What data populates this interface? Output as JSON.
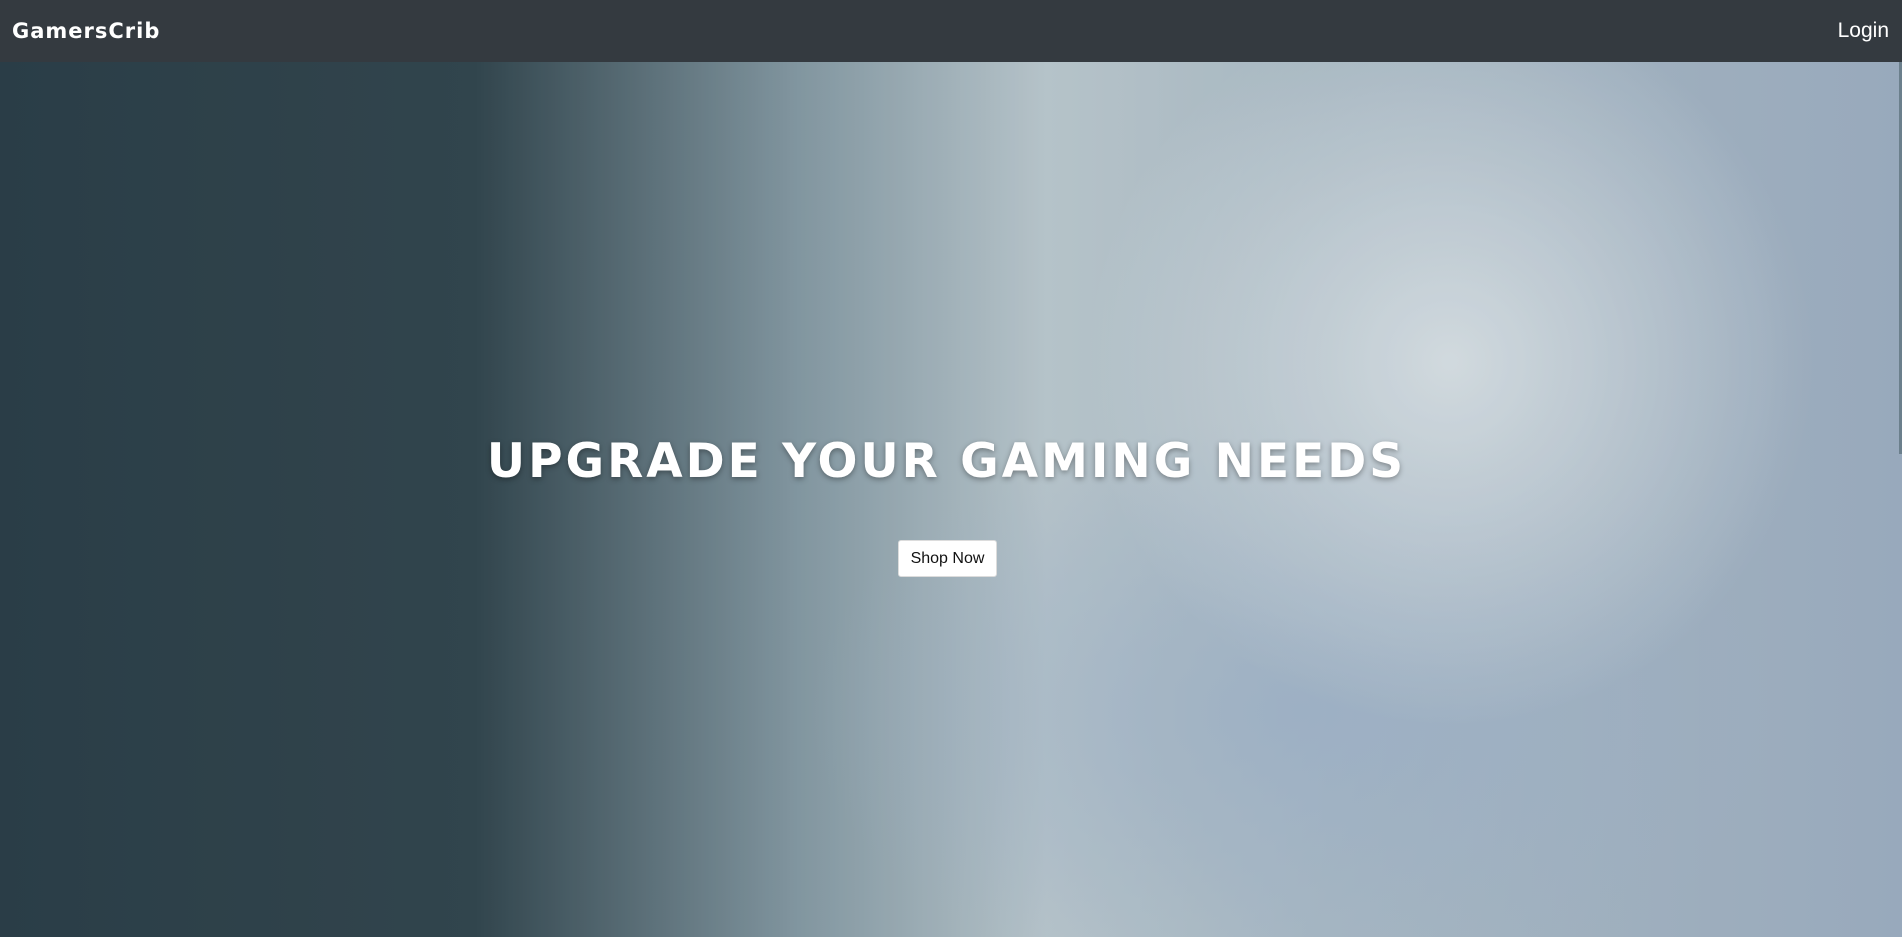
{
  "navbar": {
    "brand": "GamersCrib",
    "login_label": "Login"
  },
  "hero": {
    "headline": "UPGRADE YOUR GAMING NEEDS",
    "cta_label": "Shop Now"
  },
  "colors": {
    "navbar_bg": "#343a40",
    "text_light": "#ffffff",
    "button_bg": "#ffffff"
  }
}
